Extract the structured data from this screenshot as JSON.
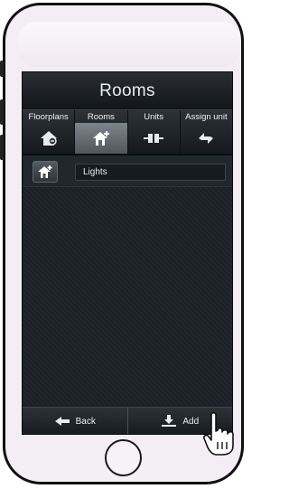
{
  "app": {
    "title": "Rooms"
  },
  "tabs": [
    {
      "label": "Floorplans",
      "icon": "floorplan-icon",
      "active": false
    },
    {
      "label": "Rooms",
      "icon": "room-house-icon",
      "active": true
    },
    {
      "label": "Units",
      "icon": "unit-plug-icon",
      "active": false
    },
    {
      "label": "Assign unit",
      "icon": "assign-unit-icon",
      "active": false
    }
  ],
  "room_row": {
    "icon": "room-house-icon",
    "name": "Lights"
  },
  "bottom": {
    "back_label": "Back",
    "add_label": "Add"
  },
  "colors": {
    "screen_bg": "#1b2127",
    "active_tab": "#6b737a",
    "text": "#e9eef3"
  }
}
